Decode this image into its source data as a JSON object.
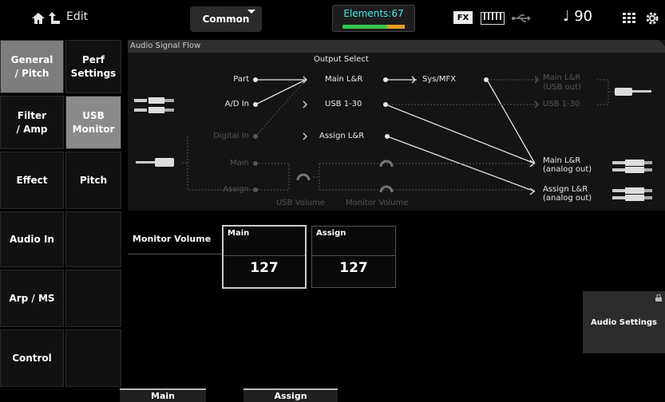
{
  "header": {
    "edit_label": "Edit",
    "common_tab": "Common",
    "elements_label": "Elements:67",
    "fx_badge": "FX",
    "tempo": "♩ 90",
    "icons": [
      "home-icon",
      "up-arrow-icon",
      "keyboard-icon",
      "usb-icon",
      "grid-icon",
      "settings-icon"
    ]
  },
  "left_tabs": {
    "col1": [
      "General\n/ Pitch",
      "Filter\n/ Amp",
      "Effect",
      "Audio In",
      "Arp / MS",
      "Control"
    ],
    "col2": [
      "Perf\nSettings",
      "USB\nMonitor",
      "Pitch"
    ]
  },
  "flow": {
    "title": "Audio Signal Flow",
    "output_select": "Output Select",
    "inputs": [
      "Part",
      "A/D In",
      "Digital In",
      "Main",
      "Assign"
    ],
    "outputs": [
      "Main L&R",
      "USB 1-30",
      "Assign L&R"
    ],
    "sys_mfx": "Sys/MFX",
    "usb_out_main": "Main L&R\n(USB out)",
    "usb_out_130": "USB 1-30",
    "analog_main": "Main L&R\n(analog out)",
    "analog_assign": "Assign L&R\n(analog out)",
    "usb_volume": "USB Volume",
    "monitor_volume": "Monitor Volume"
  },
  "monitor": {
    "label": "Monitor Volume",
    "main_header": "Main",
    "main_value": "127",
    "assign_header": "Assign",
    "assign_value": "127"
  },
  "audio_settings": "Audio Settings",
  "bottom_tabs": [
    "Main",
    "Assign"
  ]
}
